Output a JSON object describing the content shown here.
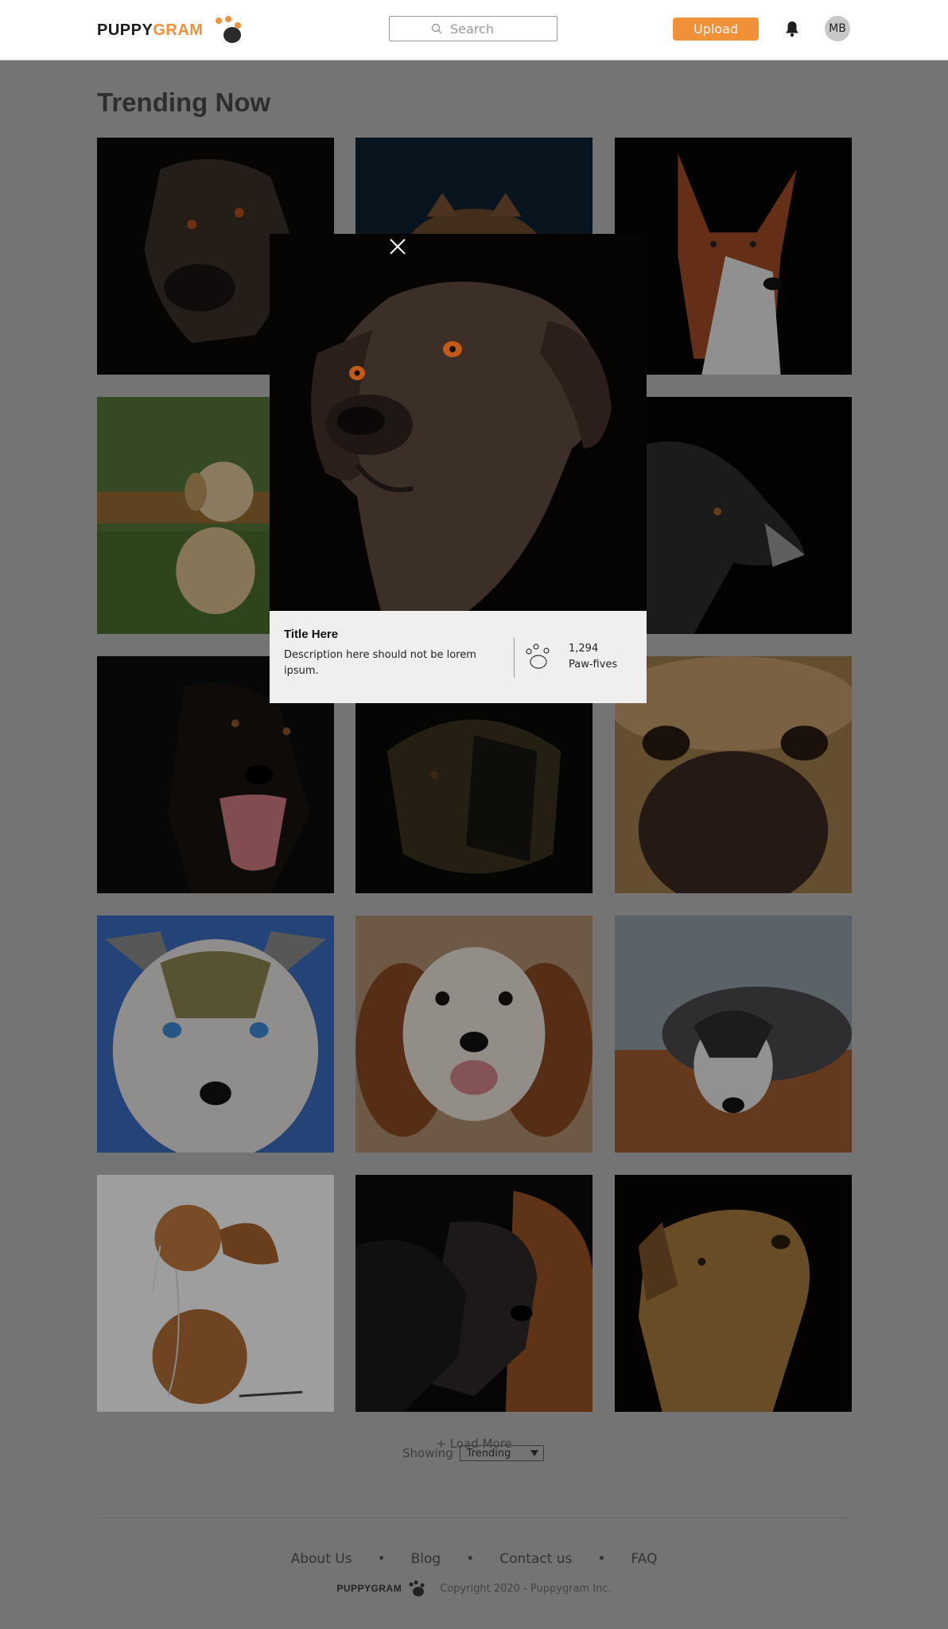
{
  "header": {
    "logo_part1": "PUPPY",
    "logo_part2": "GRAM",
    "search_placeholder": "Search",
    "upload_label": "Upload",
    "avatar_initials": "MB"
  },
  "colors": {
    "brand": "#f0913a",
    "overlay_bg": "#747474"
  },
  "main": {
    "section_title": "Trending Now",
    "tiles": [
      {
        "name": "black-lab-dark"
      },
      {
        "name": "dog-behind-blue-background"
      },
      {
        "name": "basenji-red-white"
      },
      {
        "name": "golden-puppy-in-grass"
      },
      {
        "name": "hidden-tile"
      },
      {
        "name": "border-collie-profile"
      },
      {
        "name": "black-dog-tongue-out"
      },
      {
        "name": "golden-dog-in-shadow"
      },
      {
        "name": "dog-nose-closeup"
      },
      {
        "name": "husky-puppy-blue-eyes"
      },
      {
        "name": "cavalier-king-charles"
      },
      {
        "name": "australian-shepherd-lying"
      },
      {
        "name": "puppy-with-earphones"
      },
      {
        "name": "two-dark-dogs"
      },
      {
        "name": "golden-dog-looking-up"
      }
    ],
    "load_more_label": "+ Load More",
    "showing_label": "Showing",
    "sort_selected": "Trending"
  },
  "footer": {
    "links": [
      "About Us",
      "Blog",
      "Contact us",
      "FAQ"
    ],
    "separator": "•",
    "logo_text": "PUPPYGRAM",
    "copyright": "Copyright 2020 - Puppygram Inc."
  },
  "modal": {
    "title": "Title Here",
    "description": "Description here should not be lorem ipsum.",
    "count": "1,294",
    "count_label": "Paw-fives"
  }
}
